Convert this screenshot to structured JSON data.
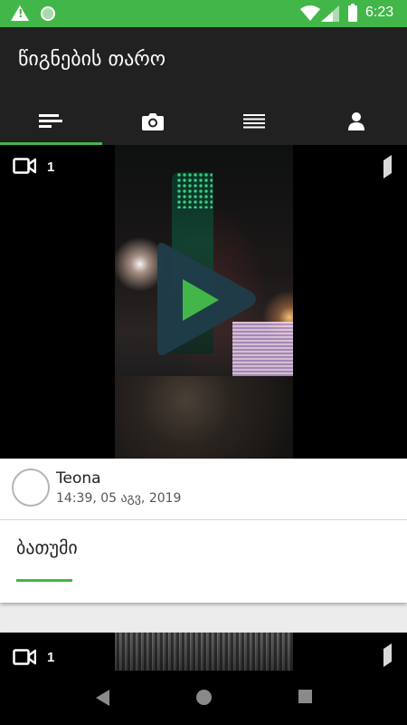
{
  "status_bar": {
    "time": "6:23",
    "icons": [
      "warning-icon",
      "sync-indicator-icon",
      "wifi-icon",
      "signal-icon",
      "battery-icon"
    ]
  },
  "app": {
    "title": "წიგნების თარო",
    "tabs": [
      {
        "icon": "feed-icon",
        "active": true
      },
      {
        "icon": "camera-icon",
        "active": false
      },
      {
        "icon": "list-icon",
        "active": false
      },
      {
        "icon": "profile-icon",
        "active": false
      }
    ]
  },
  "posts": [
    {
      "media_type": "video",
      "media_count": "1",
      "author": "Teona",
      "date": "14:39, 05 აგვ, 2019",
      "title": "ბათუმი"
    },
    {
      "media_type": "video",
      "media_count": "1"
    }
  ],
  "colors": {
    "accent": "#43b649",
    "app_bar": "#212121",
    "play_triangle": "#1f3d4a",
    "play_inner": "#43b649"
  },
  "nav": [
    "back-icon",
    "home-icon",
    "recents-icon"
  ]
}
